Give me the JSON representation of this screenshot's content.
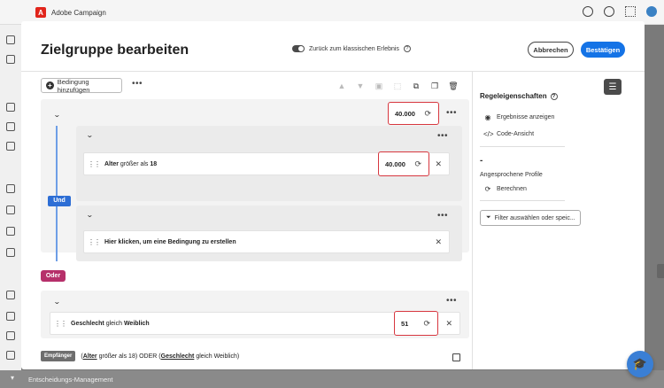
{
  "app": {
    "brand": "Adobe Campaign",
    "bottom_label": "Entscheidungs-Management"
  },
  "modal": {
    "title": "Zielgruppe bearbeiten",
    "toggle_label": "Zurück zum klassischen Erlebnis",
    "cancel_label": "Abbrechen",
    "confirm_label": "Bestätigen"
  },
  "toolbar": {
    "add_condition_label": "Bedingung hinzufügen"
  },
  "builder": {
    "group_and": {
      "count": "40.000",
      "operator": "Und",
      "condition1": {
        "field": "Alter",
        "operator": "größer als",
        "value": "18",
        "count": "40.000"
      },
      "condition2": {
        "placeholder": "Hier klicken, um eine Bedingung zu erstellen"
      }
    },
    "or_operator": "Oder",
    "group_or": {
      "condition": {
        "field": "Geschlecht",
        "operator": "gleich",
        "value": "Weiblich",
        "count": "51"
      }
    },
    "expression": {
      "badge": "Empfänger",
      "open1": "(",
      "field1": "Alter",
      "rest1": "größer als 18) ODER (",
      "field2": "Geschlecht",
      "rest2": "gleich Weiblich)"
    }
  },
  "panel": {
    "title": "Regeleigenschaften",
    "show_results": "Ergebnisse anzeigen",
    "code_view": "Code-Ansicht",
    "dash": "-",
    "profiles_label": "Angesprochene Profile",
    "compute_label": "Berechnen",
    "filter_label": "Filter auswählen oder speic..."
  }
}
